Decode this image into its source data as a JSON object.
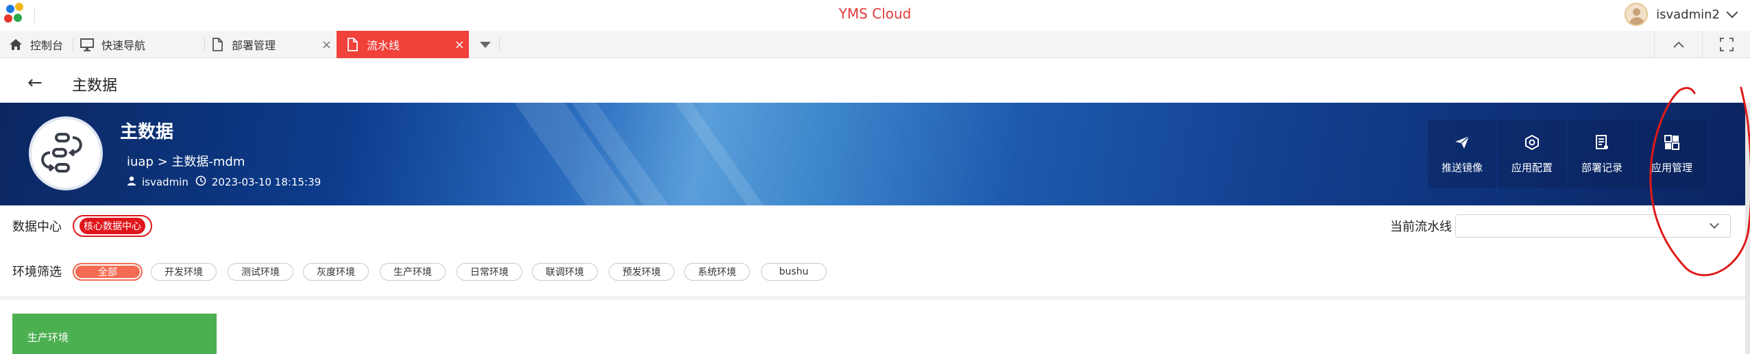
{
  "app": {
    "title": "YMS Cloud",
    "user": "isvadmin2"
  },
  "tabs": [
    {
      "label": "控制台",
      "icon": "home-icon",
      "closable": false
    },
    {
      "label": "快速导航",
      "icon": "monitor-icon",
      "closable": false
    },
    {
      "label": "部署管理",
      "icon": "document-icon",
      "closable": true
    },
    {
      "label": "流水线",
      "icon": "document-icon",
      "closable": true,
      "active": true
    }
  ],
  "page": {
    "title": "主数据"
  },
  "banner": {
    "title": "主数据",
    "path": "iuap > 主数据-mdm",
    "author": "isvadmin",
    "datetime": "2023-03-10 18:15:39",
    "actions": [
      {
        "label": "推送镜像",
        "icon": "paper-plane-icon"
      },
      {
        "label": "应用配置",
        "icon": "hexagon-gear-icon"
      },
      {
        "label": "部署记录",
        "icon": "record-icon"
      },
      {
        "label": "应用管理",
        "icon": "grid-icon"
      }
    ]
  },
  "filters": {
    "datacenter_label": "数据中心",
    "datacenter_value": "核心数据中心",
    "pipeline_label": "当前流水线",
    "pipeline_value": "",
    "env_label": "环境筛选",
    "env_options": [
      "全部",
      "开发环境",
      "测试环境",
      "灰度环境",
      "生产环境",
      "日常环境",
      "联调环境",
      "预发环境",
      "系统环境",
      "bushu"
    ],
    "env_selected": "全部"
  },
  "env_cards": [
    {
      "label": "生产环境",
      "color": "#4caf50"
    }
  ],
  "colors": {
    "brand_red": "#e23b3b",
    "active_tab": "#f0413a",
    "chip_active": "#f36b52",
    "banner_dark": "#0b2761"
  }
}
